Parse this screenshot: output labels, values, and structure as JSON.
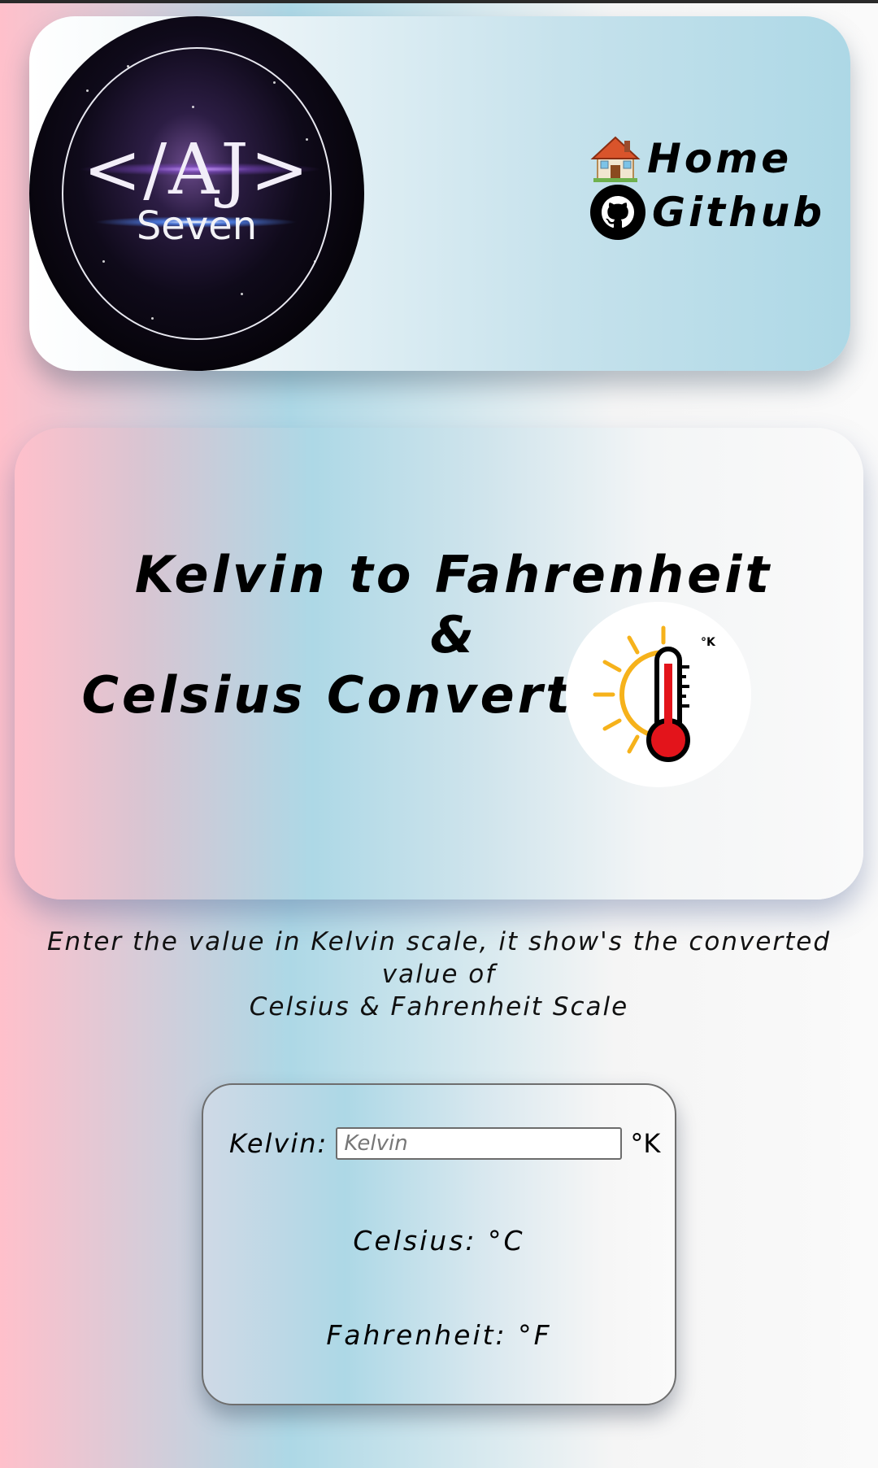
{
  "header": {
    "logo": {
      "main_text": "</AJ>",
      "sub_text": "Seven"
    },
    "nav": [
      {
        "label": "Home",
        "icon": "house-icon"
      },
      {
        "label": "Github",
        "icon": "github-icon"
      }
    ]
  },
  "hero": {
    "title_line1": "Kelvin to Fahrenheit &",
    "title_line2": "Celsius Converter",
    "icon": "thermometer-sun-icon",
    "icon_unit": "°K"
  },
  "description": {
    "line1": "Enter the value in Kelvin scale, it show's the converted value of",
    "line2": "Celsius & Fahrenheit Scale"
  },
  "converter": {
    "kelvin_label": "Kelvin:",
    "kelvin_value": "",
    "kelvin_placeholder": "Kelvin",
    "kelvin_unit": "°K",
    "celsius_text": "Celsius: °C",
    "fahrenheit_text": "Fahrenheit: °F"
  },
  "colors": {
    "gradient_pink": "#ffc0cb",
    "gradient_blue": "#add8e6",
    "gradient_white": "#f5f5f5",
    "thermo_red": "#e3141b",
    "sun_yellow": "#f6b21b"
  }
}
